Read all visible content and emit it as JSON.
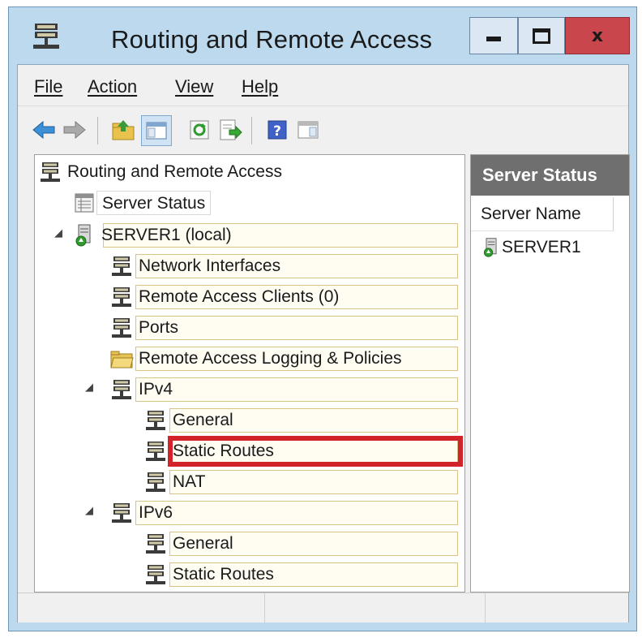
{
  "window": {
    "title": "Routing and Remote Access",
    "close_glyph": "x"
  },
  "menu": {
    "items": [
      "File",
      "Action",
      "View",
      "Help"
    ]
  },
  "toolbar": {
    "buttons": [
      "back-arrow-icon",
      "forward-arrow-icon",
      "up-folder-icon",
      "show-hide-tree-icon",
      "refresh-icon",
      "export-list-icon",
      "help-icon",
      "properties-icon"
    ]
  },
  "tree": {
    "root": "Routing and Remote Access",
    "server_status": "Server Status",
    "server": "SERVER1 (local)",
    "network_interfaces": "Network Interfaces",
    "remote_access_clients": "Remote Access Clients (0)",
    "ports": "Ports",
    "logging_policies": "Remote Access Logging & Policies",
    "ipv4": "IPv4",
    "ipv4_general": "General",
    "ipv4_static_routes": "Static Routes",
    "ipv4_nat": "NAT",
    "ipv6": "IPv6",
    "ipv6_general": "General",
    "ipv6_static_routes": "Static Routes"
  },
  "results": {
    "header": "Server Status",
    "column": "Server Name",
    "rows": [
      "SERVER1"
    ]
  },
  "colors": {
    "frame": "#bcd9ee",
    "close_button": "#c9464c",
    "highlight": "#d2232a",
    "result_header": "#6f6f6f"
  }
}
